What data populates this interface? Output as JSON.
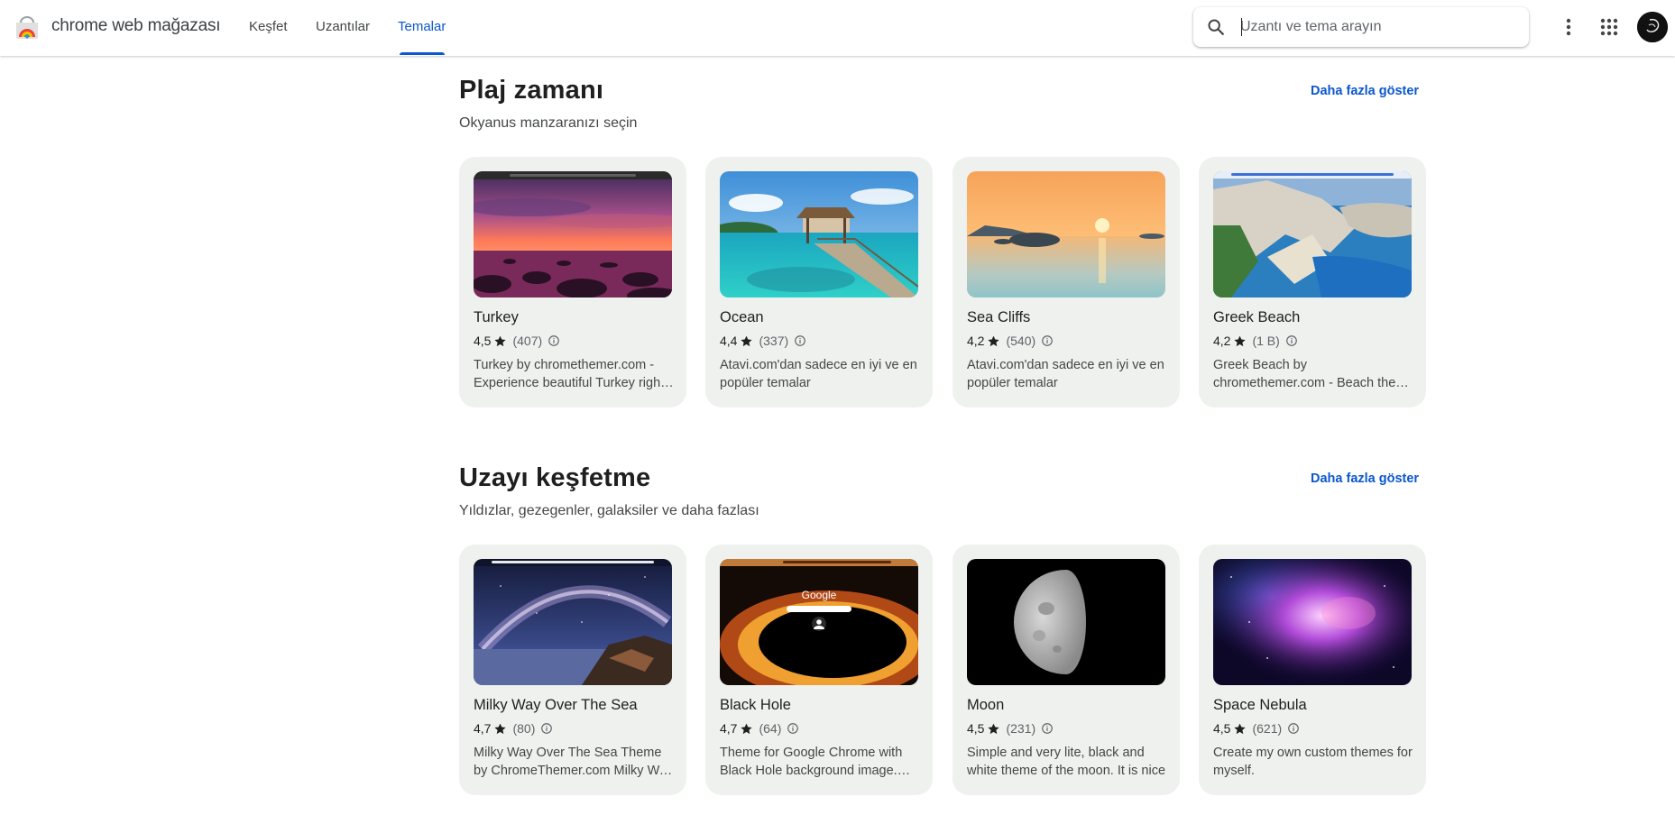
{
  "header": {
    "brand": "chrome web mağazası",
    "nav": [
      {
        "label": "Keşfet",
        "active": false
      },
      {
        "label": "Uzantılar",
        "active": false
      },
      {
        "label": "Temalar",
        "active": true
      }
    ],
    "search": {
      "placeholder": "Uzantı ve tema arayın",
      "value": ""
    },
    "accent_color": "#0b57d0"
  },
  "sections": [
    {
      "title": "Plaj zamanı",
      "subtitle": "Okyanus manzaranızı seçin",
      "more_label": "Daha fazla göster",
      "cards": [
        {
          "title": "Turkey",
          "rating": "4,5",
          "count": "(407)",
          "desc": "Turkey by chromethemer.com - Experience beautiful Turkey right in your browser"
        },
        {
          "title": "Ocean",
          "rating": "4,4",
          "count": "(337)",
          "desc": "Atavi.com'dan sadece en iyi ve en popüler temalar"
        },
        {
          "title": "Sea Cliffs",
          "rating": "4,2",
          "count": "(540)",
          "desc": "Atavi.com'dan sadece en iyi ve en popüler temalar"
        },
        {
          "title": "Greek Beach",
          "rating": "4,2",
          "count": "(1 B)",
          "desc": "Greek Beach by chromethemer.com - Beach theme for your browser"
        }
      ]
    },
    {
      "title": "Uzayı keşfetme",
      "subtitle": "Yıldızlar, gezegenler, galaksiler ve daha fazlası",
      "more_label": "Daha fazla göster",
      "cards": [
        {
          "title": "Milky Way Over The Sea",
          "rating": "4,7",
          "count": "(80)",
          "desc": "Milky Way Over The Sea Theme by ChromeThemer.com Milky Way over the sea"
        },
        {
          "title": "Black Hole",
          "rating": "4,7",
          "count": "(64)",
          "desc": "Theme for Google Chrome with Black Hole background image. Theme"
        },
        {
          "title": "Moon",
          "rating": "4,5",
          "count": "(231)",
          "desc": "Simple and very lite, black and white theme of the moon. It is nice"
        },
        {
          "title": "Space Nebula",
          "rating": "4,5",
          "count": "(621)",
          "desc": "Create my own custom themes for myself."
        }
      ]
    }
  ],
  "thumb_texts": {
    "black_hole_logo": "Google"
  }
}
